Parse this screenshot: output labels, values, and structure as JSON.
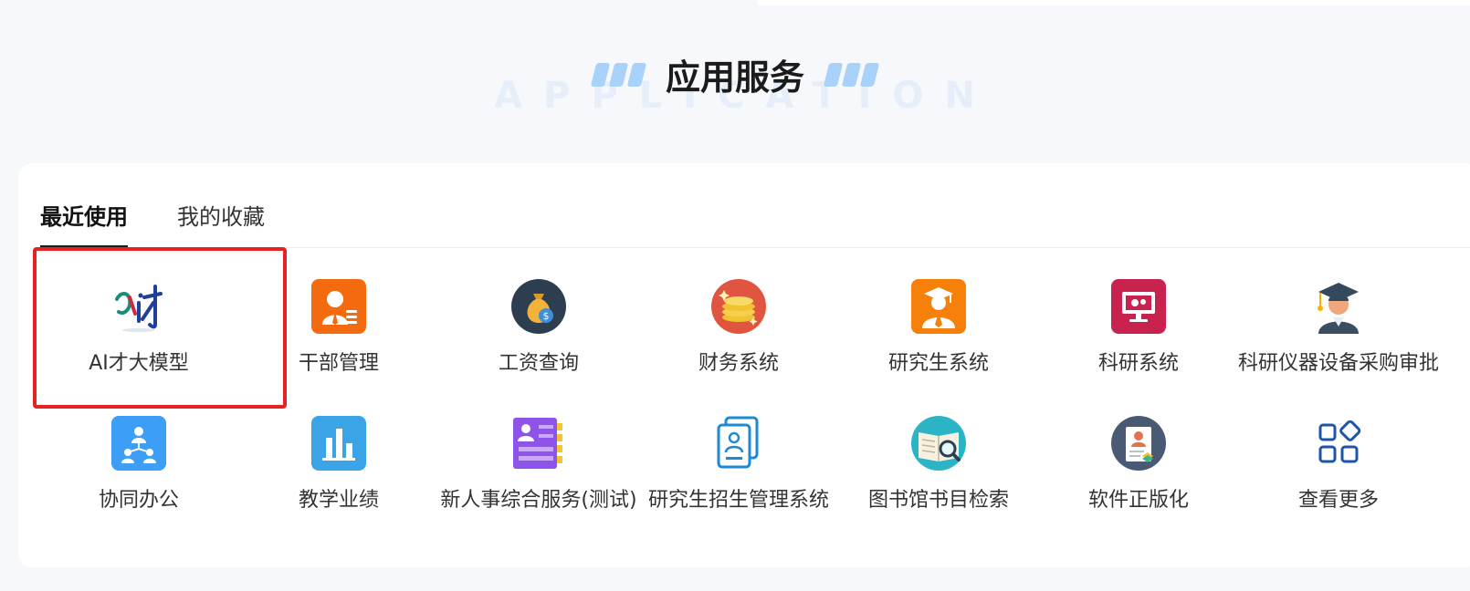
{
  "header": {
    "title": "应用服务",
    "watermark": "APPLICATION"
  },
  "tabs": [
    {
      "label": "最近使用",
      "active": true
    },
    {
      "label": "我的收藏",
      "active": false
    }
  ],
  "apps": [
    {
      "label": "AI才大模型",
      "icon": "ai-cai-logo-icon",
      "selected": true
    },
    {
      "label": "干部管理",
      "icon": "cadre-management-icon",
      "color": "#f46b0f"
    },
    {
      "label": "工资查询",
      "icon": "money-bag-icon",
      "color": "#2c3e50"
    },
    {
      "label": "财务系统",
      "icon": "coins-icon",
      "color": "#e0553f"
    },
    {
      "label": "研究生系统",
      "icon": "graduate-student-icon",
      "color": "#f7800b"
    },
    {
      "label": "科研系统",
      "icon": "monitor-gears-icon",
      "color": "#c8234f"
    },
    {
      "label": "科研仪器设备采购审批",
      "icon": "professor-avatar-icon"
    },
    {
      "label": "协同办公",
      "icon": "org-chart-icon",
      "color": "#3d9ef5"
    },
    {
      "label": "教学业绩",
      "icon": "bar-chart-icon",
      "color": "#3ba4e6"
    },
    {
      "label": "新人事综合服务(测试)",
      "icon": "profile-list-icon",
      "color": "#8e53e8"
    },
    {
      "label": "研究生招生管理系统",
      "icon": "id-card-icon",
      "color": "#1e8ad6"
    },
    {
      "label": "图书馆书目检索",
      "icon": "book-search-icon",
      "color": "#2bb3c6"
    },
    {
      "label": "软件正版化",
      "icon": "certificate-icon",
      "color": "#4b5a74"
    },
    {
      "label": "查看更多",
      "icon": "more-apps-icon",
      "color": "#1d56a8"
    }
  ]
}
